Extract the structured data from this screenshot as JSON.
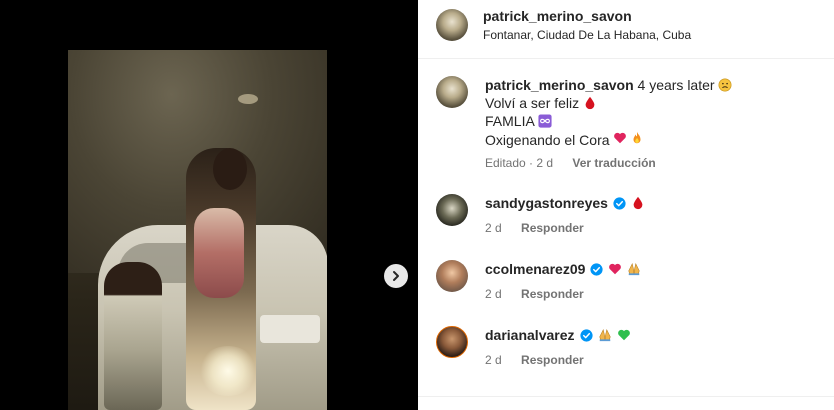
{
  "post": {
    "author": "patrick_merino_savon",
    "location": "Fontanar, Ciudad De La Habana, Cuba",
    "caption": {
      "username": "patrick_merino_savon",
      "line1": "4 years later",
      "line2": "Volví a ser feliz",
      "line3": "FAMLIA",
      "line4": "Oxigenando el Cora"
    },
    "meta": {
      "edited": "Editado · 2 d",
      "translate": "Ver traducción"
    }
  },
  "comments": [
    {
      "username": "sandygastonreyes",
      "verified": true,
      "time": "2 d",
      "reply": "Responder"
    },
    {
      "username": "ccolmenarez09",
      "verified": true,
      "time": "2 d",
      "reply": "Responder"
    },
    {
      "username": "darianalvarez",
      "verified": true,
      "time": "2 d",
      "reply": "Responder"
    }
  ],
  "icons": {
    "next": "chevron-right-icon",
    "verified": "verified-badge-icon",
    "blood_drop": "drop-of-blood-icon",
    "infinity": "infinity-icon",
    "heart": "red-heart-icon",
    "fire": "fire-icon",
    "pray": "folded-hands-icon",
    "green_heart": "green-heart-icon",
    "sad": "slightly-frowning-face-icon"
  },
  "colors": {
    "verified": "#0095f6",
    "link_gray": "#737373",
    "heart": "#e0245e",
    "infinity_bg": "#8a5cd6",
    "green_heart": "#2fbf4e"
  }
}
